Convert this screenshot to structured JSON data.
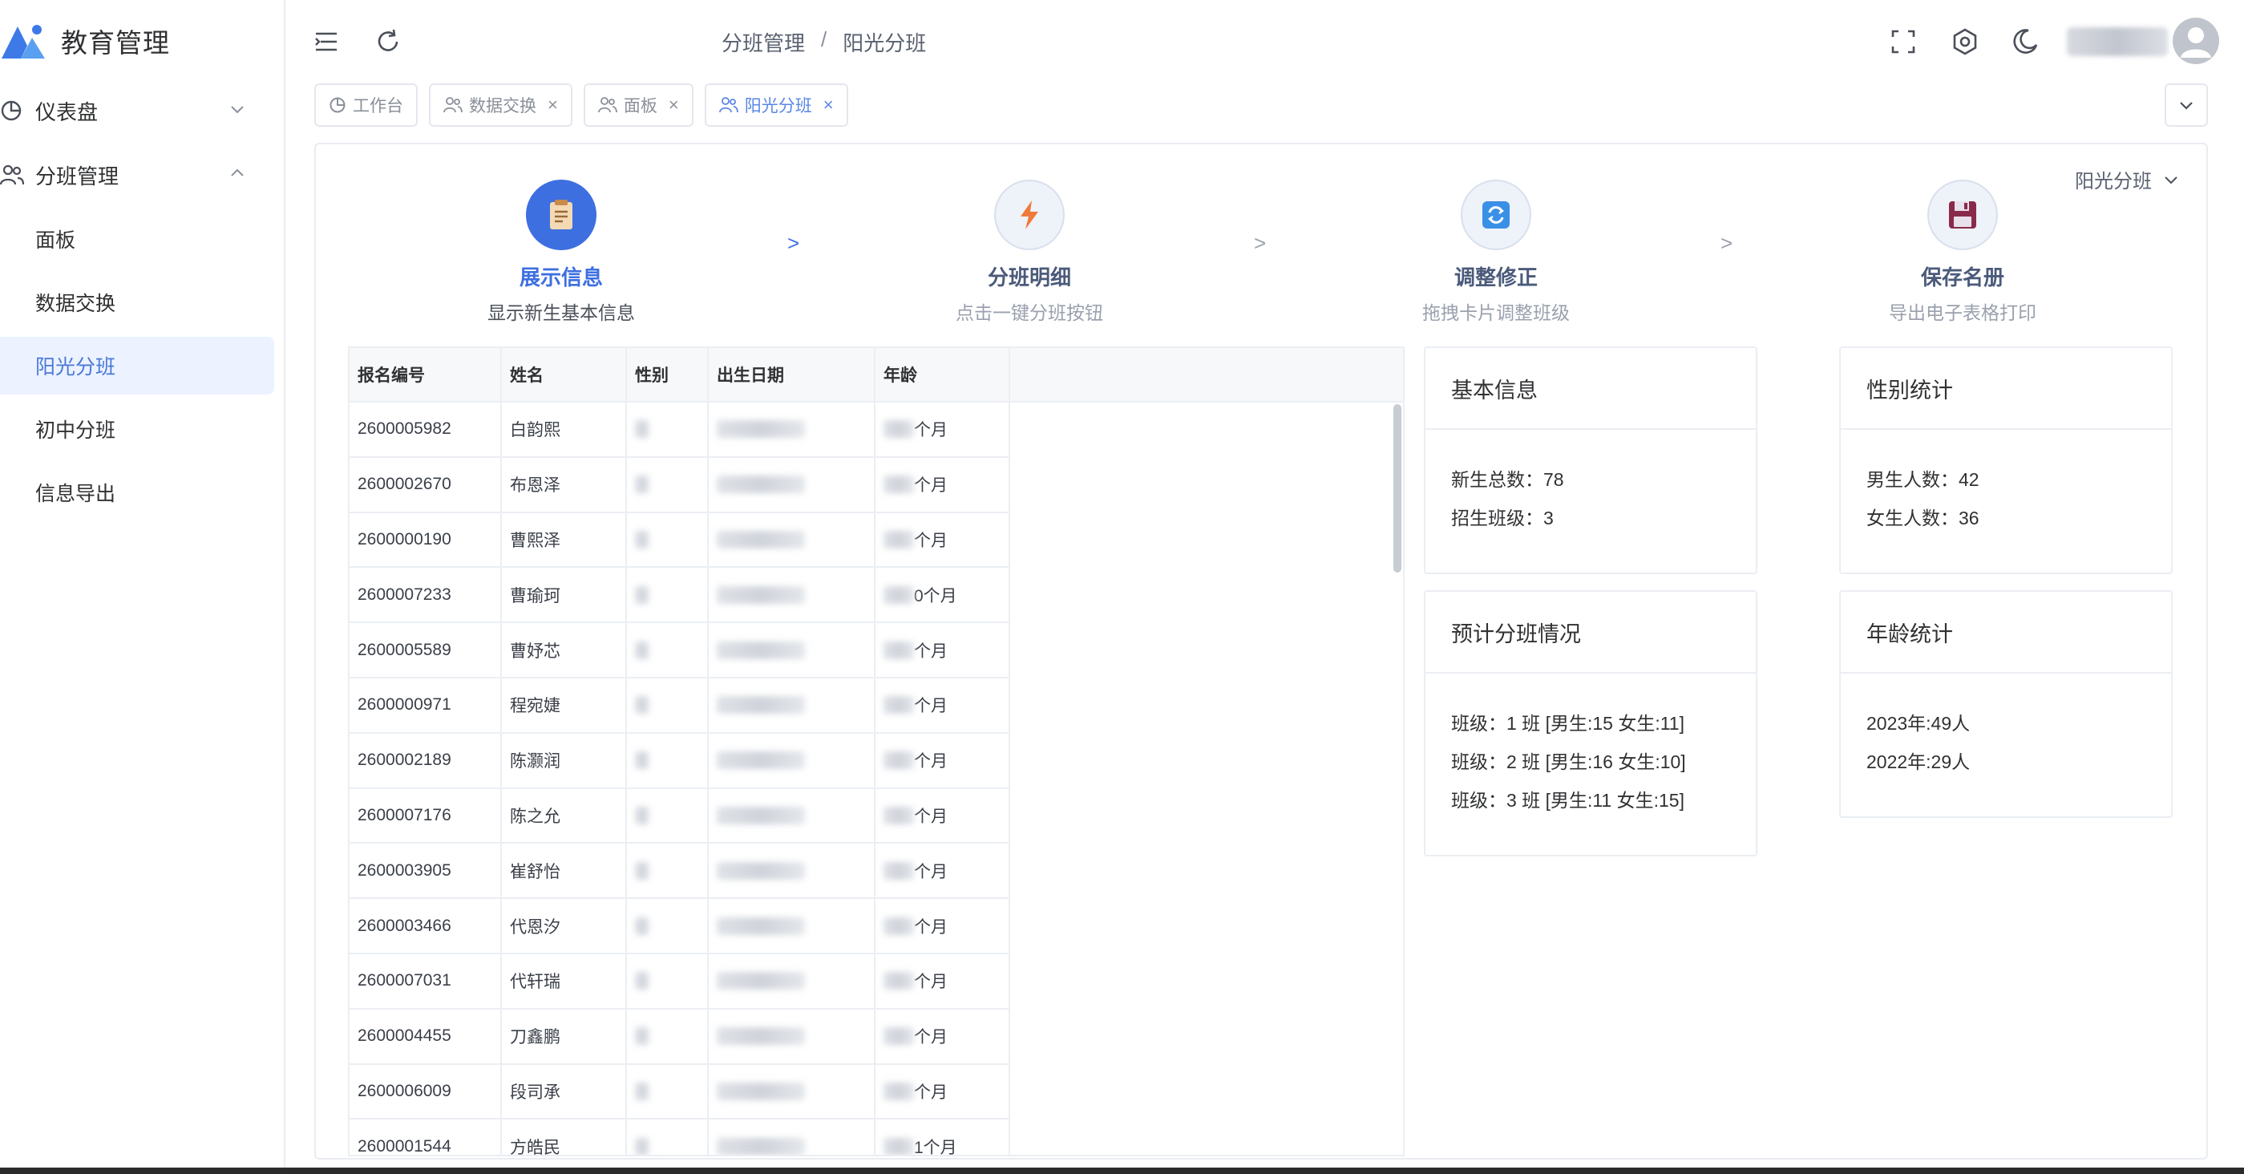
{
  "app": {
    "title": "教育管理"
  },
  "sidebar": {
    "items": [
      {
        "label": "仪表盘",
        "icon": "pie-chart-icon",
        "expanded": false
      },
      {
        "label": "分班管理",
        "icon": "users-icon",
        "expanded": true
      }
    ],
    "sub_items": [
      {
        "label": "面板",
        "active": false
      },
      {
        "label": "数据交换",
        "active": false
      },
      {
        "label": "阳光分班",
        "active": true
      },
      {
        "label": "初中分班",
        "active": false
      },
      {
        "label": "信息导出",
        "active": false
      }
    ]
  },
  "header": {
    "breadcrumb": [
      "分班管理",
      "阳光分班"
    ],
    "breadcrumb_sep": "/"
  },
  "tags": [
    {
      "label": "工作台",
      "closable": false,
      "active": false
    },
    {
      "label": "数据交换",
      "closable": true,
      "active": false
    },
    {
      "label": "面板",
      "closable": true,
      "active": false
    },
    {
      "label": "阳光分班",
      "closable": true,
      "active": true
    }
  ],
  "tag_close": "×",
  "main": {
    "select_value": "阳光分班",
    "steps": [
      {
        "title": "展示信息",
        "desc": "显示新生基本信息",
        "active": true
      },
      {
        "title": "分班明细",
        "desc": "点击一键分班按钮",
        "active": false
      },
      {
        "title": "调整修正",
        "desc": "拖拽卡片调整班级",
        "active": false
      },
      {
        "title": "保存名册",
        "desc": "导出电子表格打印",
        "active": false
      }
    ],
    "step_separator": ">",
    "table": {
      "columns": [
        "报名编号",
        "姓名",
        "性别",
        "出生日期",
        "年龄"
      ],
      "rows": [
        {
          "id": "2600005982",
          "name": "白韵熙",
          "age_suffix": "个月"
        },
        {
          "id": "2600002670",
          "name": "布恩泽",
          "age_suffix": "个月"
        },
        {
          "id": "2600000190",
          "name": "曹熙泽",
          "age_suffix": "个月"
        },
        {
          "id": "2600007233",
          "name": "曹瑜珂",
          "age_suffix": "0个月"
        },
        {
          "id": "2600005589",
          "name": "曹妤芯",
          "age_suffix": "个月"
        },
        {
          "id": "2600000971",
          "name": "程宛婕",
          "age_suffix": "个月"
        },
        {
          "id": "2600002189",
          "name": "陈灏润",
          "age_suffix": "个月"
        },
        {
          "id": "2600007176",
          "name": "陈之允",
          "age_suffix": "个月"
        },
        {
          "id": "2600003905",
          "name": "崔舒怡",
          "age_suffix": "个月"
        },
        {
          "id": "2600003466",
          "name": "代恩汐",
          "age_suffix": "个月"
        },
        {
          "id": "2600007031",
          "name": "代轩瑞",
          "age_suffix": "个月"
        },
        {
          "id": "2600004455",
          "name": "刀鑫鹏",
          "age_suffix": "个月"
        },
        {
          "id": "2600006009",
          "name": "段司承",
          "age_suffix": "个月"
        },
        {
          "id": "2600001544",
          "name": "方皓民",
          "age_suffix": "1个月"
        }
      ]
    },
    "cards": {
      "basic": {
        "title": "基本信息",
        "lines": [
          "新生总数：78",
          "招生班级：3"
        ]
      },
      "gender": {
        "title": "性别统计",
        "lines": [
          "男生人数：42",
          "女生人数：36"
        ]
      },
      "plan": {
        "title": "预计分班情况",
        "lines": [
          "班级：1 班 [男生:15 女生:11]",
          "班级：2 班 [男生:16 女生:10]",
          "班级：3 班 [男生:11 女生:15]"
        ]
      },
      "age": {
        "title": "年龄统计",
        "lines": [
          "2023年:49人",
          "2022年:29人"
        ]
      }
    }
  },
  "colors": {
    "accent": "#3d6fe0",
    "active_bg": "#ecf2ff",
    "border": "#ebeef3"
  }
}
